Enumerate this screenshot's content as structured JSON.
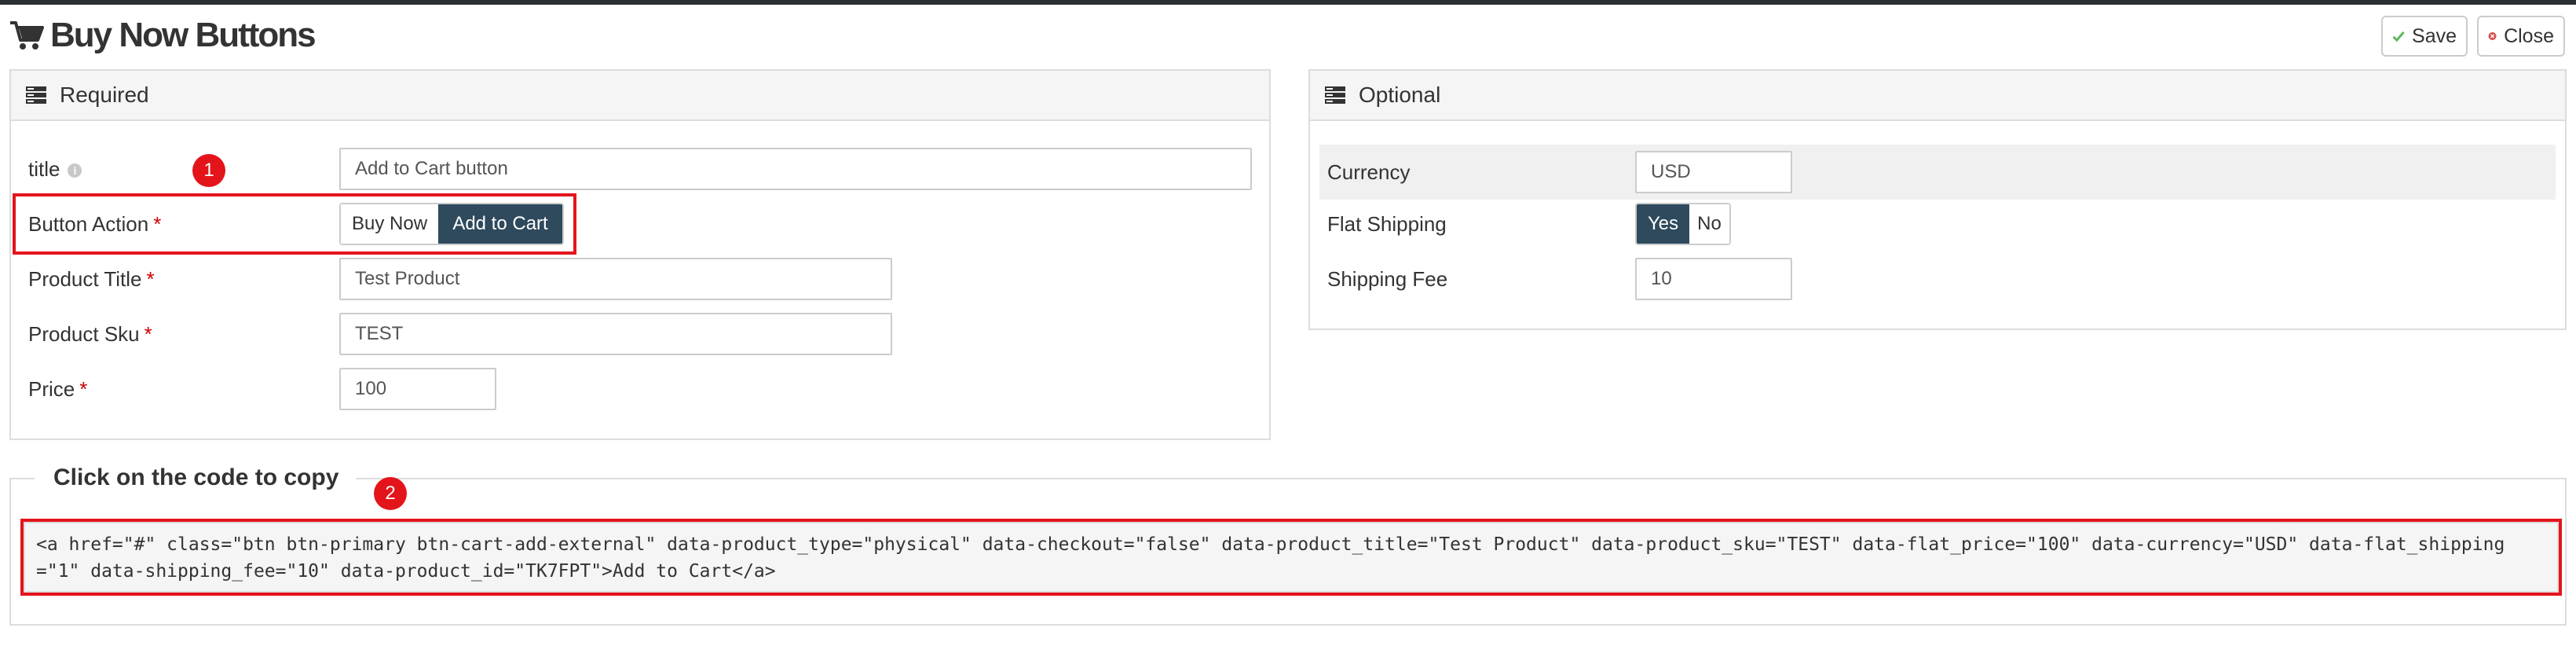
{
  "header": {
    "title": "Buy Now Buttons",
    "save_label": "Save",
    "close_label": "Close"
  },
  "required": {
    "heading": "Required",
    "fields": {
      "title": {
        "label": "title",
        "value": "Add to Cart button"
      },
      "button_action": {
        "label": "Button Action",
        "options": [
          "Buy Now",
          "Add to Cart"
        ],
        "selected": "Add to Cart"
      },
      "product_title": {
        "label": "Product Title",
        "value": "Test Product"
      },
      "product_sku": {
        "label": "Product Sku",
        "value": "TEST"
      },
      "price": {
        "label": "Price",
        "value": "100"
      }
    },
    "required_mark": "*"
  },
  "optional": {
    "heading": "Optional",
    "fields": {
      "currency": {
        "label": "Currency",
        "value": "USD"
      },
      "flat_shipping": {
        "label": "Flat Shipping",
        "options": [
          "Yes",
          "No"
        ],
        "selected": "Yes"
      },
      "shipping_fee": {
        "label": "Shipping Fee",
        "value": "10"
      }
    }
  },
  "code_section": {
    "legend": "Click on the code to copy",
    "code": "<a href=\"#\" class=\"btn btn-primary btn-cart-add-external\" data-product_type=\"physical\" data-checkout=\"false\" data-product_title=\"Test Product\" data-product_sku=\"TEST\" data-flat_price=\"100\" data-currency=\"USD\" data-flat_shipping=\"1\" data-shipping_fee=\"10\" data-product_id=\"TK7FPT\">Add to Cart</a>"
  },
  "annotations": {
    "badge_1": "1",
    "badge_2": "2"
  },
  "colors": {
    "active_toggle": "#2e4a5c",
    "highlight": "#e4141b",
    "required_star": "#cc0000",
    "save_check": "#5cb85c",
    "close_icon": "#d9534f"
  }
}
